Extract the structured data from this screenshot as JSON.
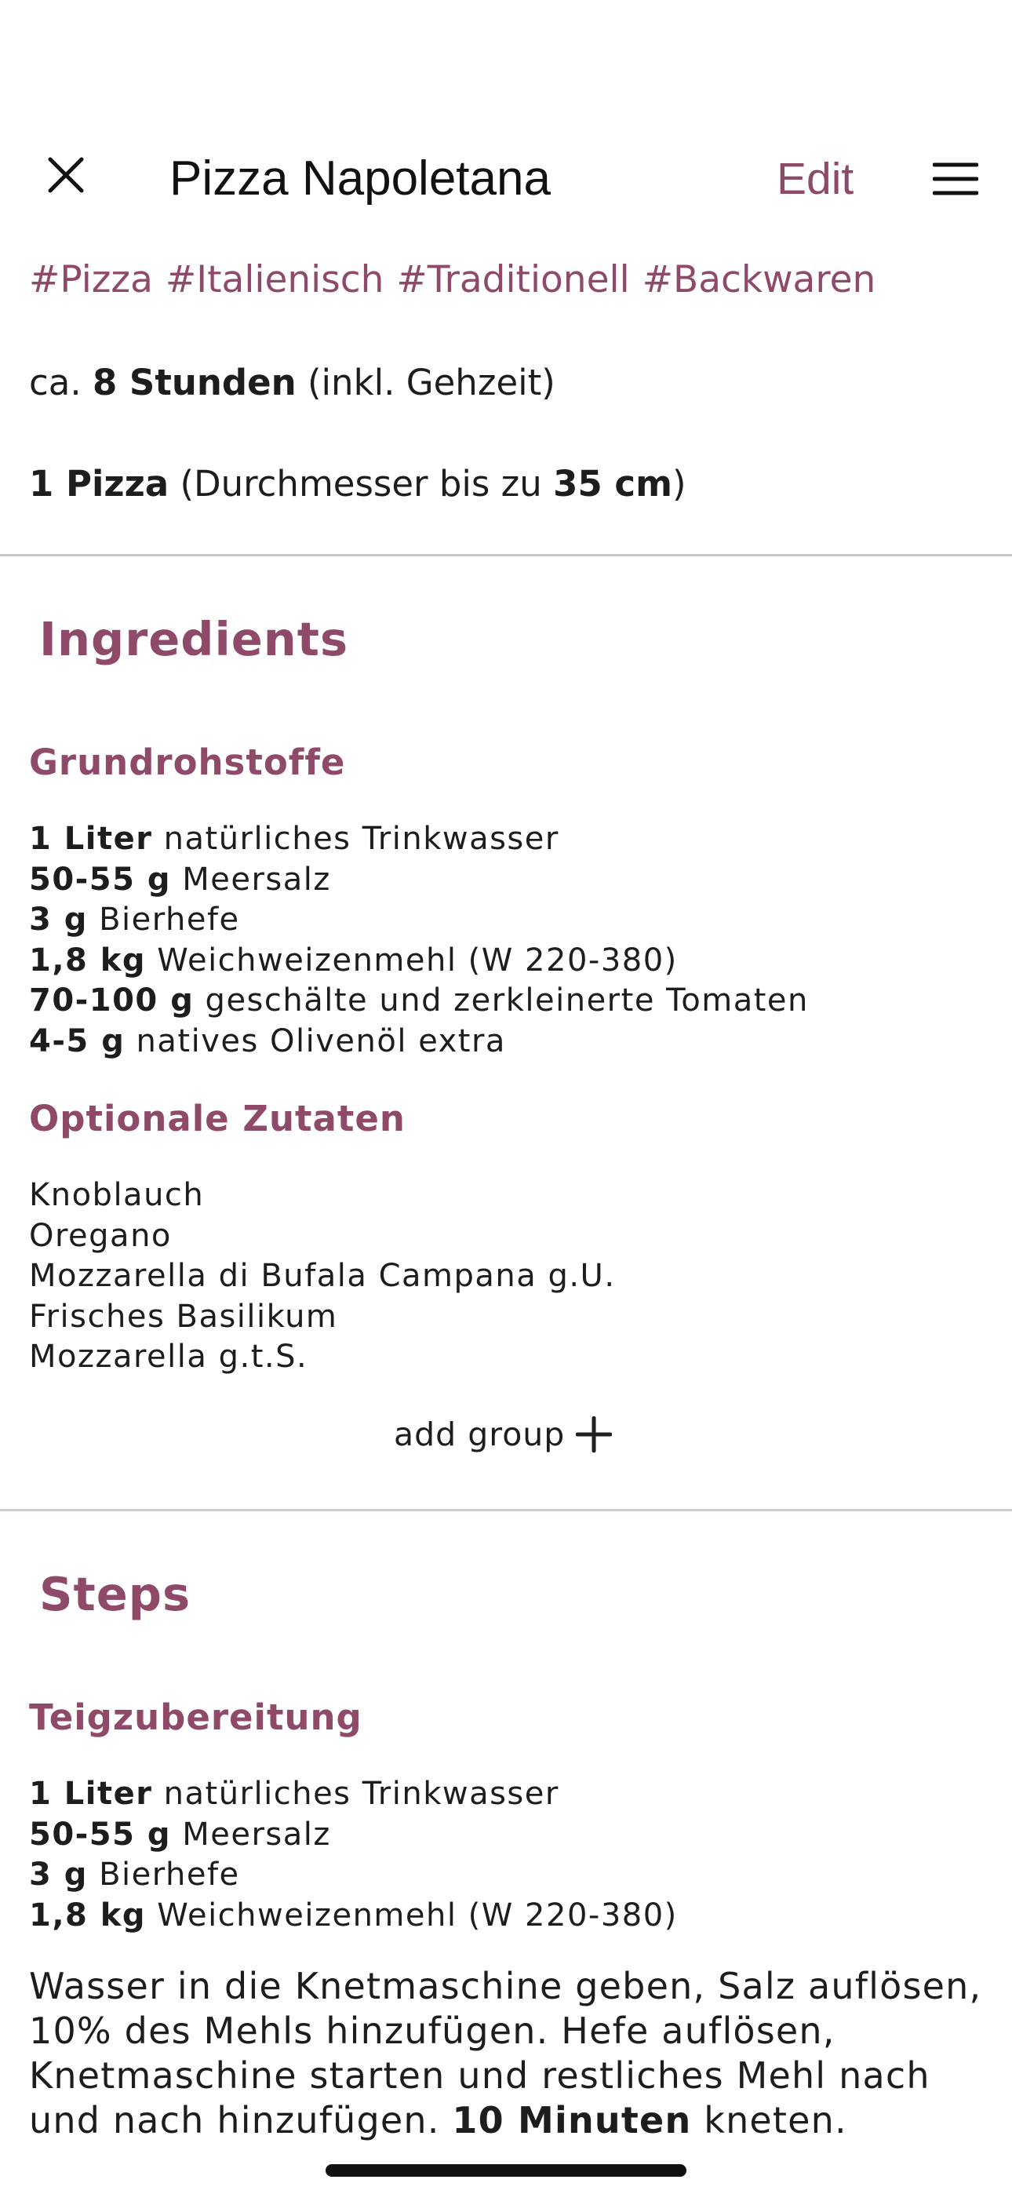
{
  "header": {
    "title": "Pizza Napoletana",
    "edit_label": "Edit"
  },
  "tags": [
    "#Pizza",
    "#Italienisch",
    "#Traditionell",
    "#Backwaren"
  ],
  "time": {
    "prefix": "ca. ",
    "value": "8 Stunden",
    "suffix": " (inkl. Gehzeit)"
  },
  "servings": {
    "value": "1 Pizza",
    "mid": " (Durchmesser bis zu ",
    "size": "35 cm",
    "end": ")"
  },
  "ingredients": {
    "title": "Ingredients",
    "groups": [
      {
        "name": "Grundrohstoffe",
        "items": [
          {
            "amount": "1 Liter",
            "name": "natürliches Trinkwasser"
          },
          {
            "amount": "50-55 g",
            "name": "Meersalz"
          },
          {
            "amount": "3 g",
            "name": "Bierhefe"
          },
          {
            "amount": "1,8 kg",
            "name": "Weichweizenmehl (W 220-380)"
          },
          {
            "amount": "70-100 g",
            "name": "geschälte und zerkleinerte Tomaten"
          },
          {
            "amount": "4-5 g",
            "name": "natives Olivenöl extra"
          }
        ]
      },
      {
        "name": "Optionale Zutaten",
        "items": [
          {
            "amount": "",
            "name": "Knoblauch"
          },
          {
            "amount": "",
            "name": "Oregano"
          },
          {
            "amount": "",
            "name": "Mozzarella di Bufala Campana g.U."
          },
          {
            "amount": "",
            "name": "Frisches Basilikum"
          },
          {
            "amount": "",
            "name": "Mozzarella g.t.S."
          }
        ]
      }
    ],
    "add_group_label": "add group"
  },
  "steps": {
    "title": "Steps",
    "groups": [
      {
        "name": "Teigzubereitung",
        "items": [
          {
            "amount": "1 Liter",
            "name": "natürliches Trinkwasser"
          },
          {
            "amount": "50-55 g",
            "name": "Meersalz"
          },
          {
            "amount": "3 g",
            "name": "Bierhefe"
          },
          {
            "amount": "1,8 kg",
            "name": "Weichweizenmehl (W 220-380)"
          }
        ],
        "text_before": "Wasser in die Knetmaschine geben, Salz auflösen, 10% des Mehls hinzufügen. Hefe auflösen, Knetmaschine starten und restliches Mehl nach und nach hinzufügen. ",
        "text_bold": "10 Minuten",
        "text_after": " kneten."
      }
    ]
  },
  "colors": {
    "accent": "#8e4a68",
    "text": "#1f1c1f",
    "divider": "#c9c4c8"
  },
  "icons": {
    "close": "close-icon",
    "menu": "hamburger-menu-icon",
    "add": "plus-icon"
  }
}
